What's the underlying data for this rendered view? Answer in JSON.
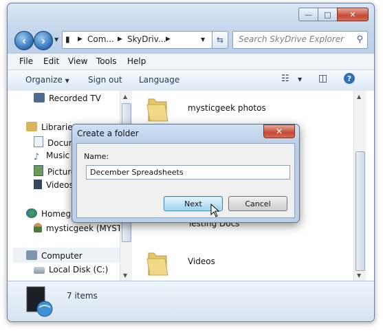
{
  "window": {
    "title_buttons": {
      "minimize": "—",
      "maximize": "□",
      "close": "✕"
    }
  },
  "address": {
    "segments": [
      "Com...",
      "SkyDriv..."
    ],
    "search_placeholder": "Search SkyDrive Explorer"
  },
  "menu": {
    "items": [
      "File",
      "Edit",
      "View",
      "Tools",
      "Help"
    ]
  },
  "toolbar": {
    "organize": "Organize",
    "sign_out": "Sign out",
    "language": "Language"
  },
  "nav_pane": {
    "items": [
      "Recorded TV",
      "Libraries",
      "Docum",
      "Music",
      "Picture",
      "Videos",
      "Homegr",
      "mysticgeek (MYST",
      "Computer",
      "Local Disk (C:)"
    ]
  },
  "files": {
    "items": [
      "mysticgeek photos",
      "Testing Docs",
      "Videos"
    ]
  },
  "status": {
    "count": "7 items"
  },
  "dialog": {
    "title": "Create a folder",
    "close": "✕",
    "name_label": "Name:",
    "name_value": "December Spreadsheets",
    "next": "Next",
    "cancel": "Cancel"
  }
}
